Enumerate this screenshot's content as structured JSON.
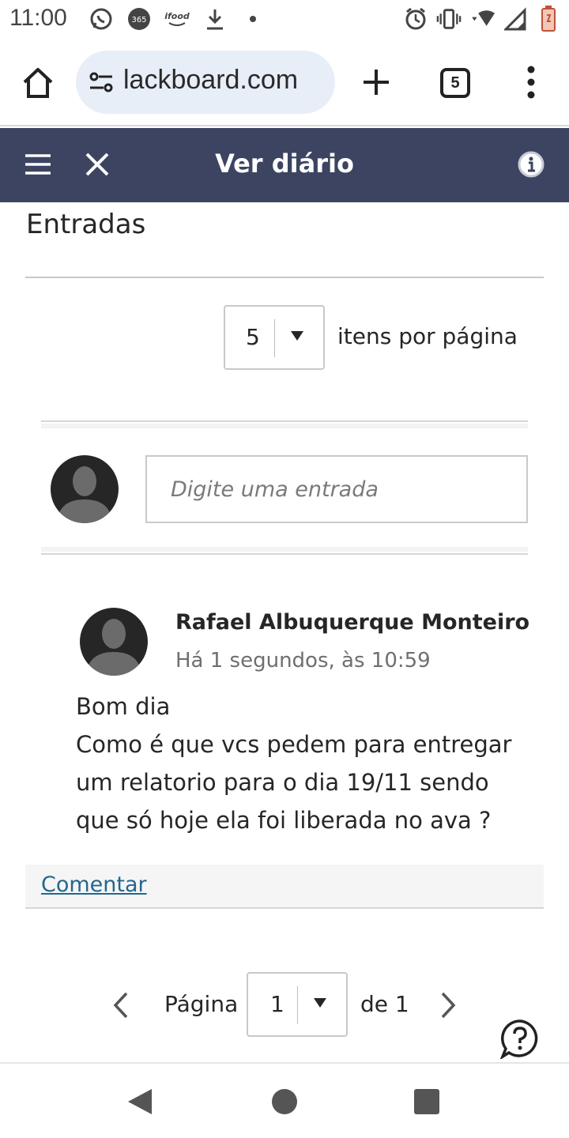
{
  "status_bar": {
    "time": "11:00",
    "left_icons": [
      "whatsapp-icon",
      "365-icon",
      "ifood-icon",
      "download-icon",
      "dot-icon"
    ],
    "right_icons": [
      "alarm-icon",
      "vibrate-icon",
      "wifi-icon",
      "signal-icon",
      "battery-icon"
    ]
  },
  "browser": {
    "url": "lackboard.com",
    "tab_count": "5"
  },
  "header": {
    "title": "Ver diário",
    "bg_color": "#3c4461"
  },
  "section": {
    "title": "Entradas"
  },
  "per_page": {
    "value": "5",
    "label": "itens por página"
  },
  "new_entry": {
    "placeholder": "Digite uma entrada"
  },
  "post": {
    "author": "Rafael Albuquerque Monteiro",
    "time": "Há 1 segundos, às 10:59",
    "lines": [
      "Bom dia",
      "Como é que vcs pedem para entregar",
      "um relatorio para o dia 19/11 sendo",
      "que só hoje ela foi liberada no ava ?"
    ],
    "comment_label": "Comentar",
    "link_color": "#23678f"
  },
  "pagination": {
    "page_label": "Página",
    "current": "1",
    "of_label": "de 1"
  }
}
